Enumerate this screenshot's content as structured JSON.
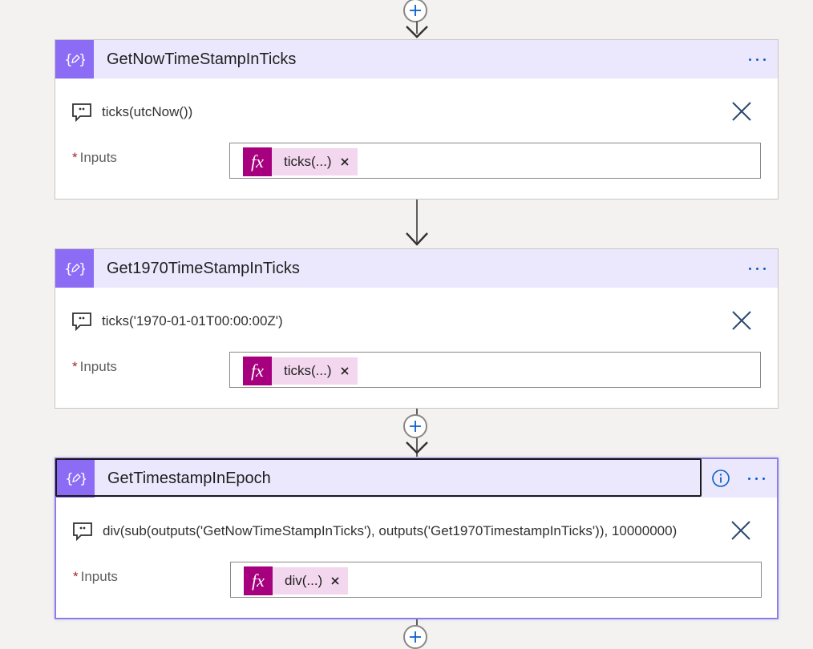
{
  "cards": [
    {
      "title": "GetNowTimeStampInTicks",
      "comment": "ticks(utcNow())",
      "inputs_label": "Inputs",
      "token_label": "ticks(...)"
    },
    {
      "title": "Get1970TimeStampInTicks",
      "comment": "ticks('1970-01-01T00:00:00Z')",
      "inputs_label": "Inputs",
      "token_label": "ticks(...)"
    },
    {
      "title": "GetTimestampInEpoch",
      "comment": "div(sub(outputs('GetNowTimeStampInTicks'), outputs('Get1970TimestampInTicks')), 10000000)",
      "inputs_label": "Inputs",
      "token_label": "div(...)"
    }
  ],
  "required_marker": "*",
  "fx_symbol": "fx",
  "colors": {
    "header_bg": "#ebe8fd",
    "icon_bg": "#8c6cf5",
    "fx_bg": "#a6007e",
    "token_bg": "#f2d7ef",
    "selected_border": "#8b7cf0",
    "accent_blue": "#0a5ec7"
  },
  "icons": [
    "add-step-icon",
    "compose-icon",
    "more-options-icon",
    "info-icon",
    "comment-icon",
    "close-icon",
    "token-remove-icon",
    "arrow-down-icon"
  ]
}
